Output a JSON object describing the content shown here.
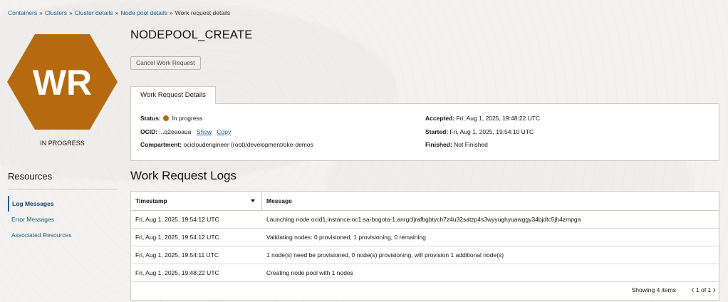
{
  "breadcrumb": [
    {
      "label": "Containers"
    },
    {
      "label": "Clusters"
    },
    {
      "label": "Cluster details"
    },
    {
      "label": "Node pool details"
    },
    {
      "label": "Work request details"
    }
  ],
  "badge": {
    "text": "WR",
    "color": "#b56a11",
    "status": "IN PROGRESS"
  },
  "sidebar": {
    "title": "Resources",
    "items": [
      {
        "label": "Log Messages",
        "active": true
      },
      {
        "label": "Error Messages"
      },
      {
        "label": "Associated Resources"
      }
    ]
  },
  "header": {
    "title": "NODEPOOL_CREATE",
    "cancel_label": "Cancel Work Request"
  },
  "details": {
    "tab_label": "Work Request Details",
    "status_label": "Status:",
    "status_value": "In progress",
    "ocid_label": "OCID:",
    "ocid_value": "...q2eaoaua",
    "show_label": "Show",
    "copy_label": "Copy",
    "compartment_label": "Compartment:",
    "compartment_value": "ocicloudengineer (root)/development/oke-demos",
    "accepted_label": "Accepted:",
    "accepted_value": "Fri, Aug 1, 2025, 19:48:22 UTC",
    "started_label": "Started:",
    "started_value": "Fri, Aug 1, 2025, 19:54:10 UTC",
    "finished_label": "Finished:",
    "finished_value": "Not Finished"
  },
  "logs": {
    "title": "Work Request Logs",
    "columns": {
      "timestamp": "Timestamp",
      "message": "Message"
    },
    "rows": [
      {
        "timestamp": "Fri, Aug 1, 2025, 19:54:12 UTC",
        "message": "Launching node ocid1.instance.oc1.sa-bogota-1.anrgcljrafbgbtych7z4u32satzp4s3wyyughyuawggy34bjdtc5jh4zmpga"
      },
      {
        "timestamp": "Fri, Aug 1, 2025, 19:54:12 UTC",
        "message": "Validating nodes: 0 provisioned, 1 provisioning, 0 remaining"
      },
      {
        "timestamp": "Fri, Aug 1, 2025, 19:54:11 UTC",
        "message": "1 node(s) need be provisioned, 0 node(s) provisioning, will provision 1 additional node(s)"
      },
      {
        "timestamp": "Fri, Aug 1, 2025, 19:48:22 UTC",
        "message": "Creating node pool with 1 nodes"
      }
    ],
    "showing": "Showing 4 items",
    "pager": "1 of 1"
  }
}
